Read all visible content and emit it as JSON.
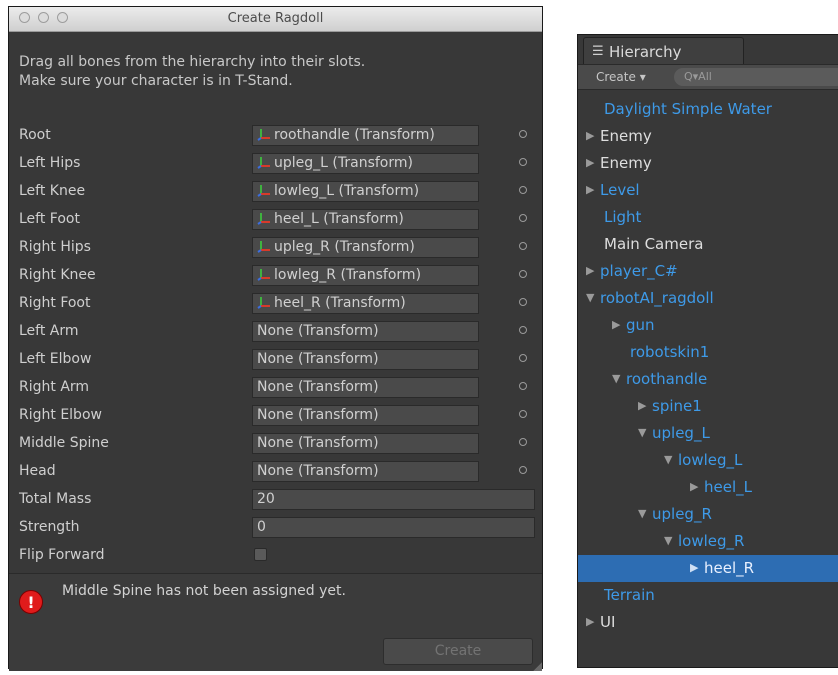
{
  "ragdoll_window": {
    "title": "Create Ragdoll",
    "instructions": [
      "Drag all bones from the hierarchy into their slots.",
      "Make sure your character is in T-Stand."
    ],
    "bone_fields": [
      {
        "label": "Root",
        "value": "roothandle (Transform)",
        "assigned": true
      },
      {
        "label": "Left Hips",
        "value": "upleg_L (Transform)",
        "assigned": true
      },
      {
        "label": "Left Knee",
        "value": "lowleg_L (Transform)",
        "assigned": true
      },
      {
        "label": "Left Foot",
        "value": "heel_L (Transform)",
        "assigned": true
      },
      {
        "label": "Right Hips",
        "value": "upleg_R (Transform)",
        "assigned": true
      },
      {
        "label": "Right Knee",
        "value": "lowleg_R (Transform)",
        "assigned": true
      },
      {
        "label": "Right Foot",
        "value": "heel_R (Transform)",
        "assigned": true
      },
      {
        "label": "Left Arm",
        "value": "None (Transform)",
        "assigned": false
      },
      {
        "label": "Left Elbow",
        "value": "None (Transform)",
        "assigned": false
      },
      {
        "label": "Right Arm",
        "value": "None (Transform)",
        "assigned": false
      },
      {
        "label": "Right Elbow",
        "value": "None (Transform)",
        "assigned": false
      },
      {
        "label": "Middle Spine",
        "value": "None (Transform)",
        "assigned": false
      },
      {
        "label": "Head",
        "value": "None (Transform)",
        "assigned": false
      }
    ],
    "total_mass": {
      "label": "Total Mass",
      "value": "20"
    },
    "strength": {
      "label": "Strength",
      "value": "0"
    },
    "flip_forward": {
      "label": "Flip Forward",
      "checked": false
    },
    "warning": "Middle Spine has not been assigned yet.",
    "create_button": "Create"
  },
  "hierarchy": {
    "tab_title": "Hierarchy",
    "create_menu": "Create ▾",
    "search_placeholder": "Q▾All",
    "nodes": [
      {
        "name": "Daylight Simple Water",
        "depth": 0,
        "arrow": "",
        "color": "active"
      },
      {
        "name": "Enemy",
        "depth": 0,
        "arrow": "▶",
        "color": "normal"
      },
      {
        "name": "Enemy",
        "depth": 0,
        "arrow": "▶",
        "color": "normal"
      },
      {
        "name": "Level",
        "depth": 0,
        "arrow": "▶",
        "color": "active"
      },
      {
        "name": "Light",
        "depth": 0,
        "arrow": "",
        "color": "active"
      },
      {
        "name": "Main Camera",
        "depth": 0,
        "arrow": "",
        "color": "normal"
      },
      {
        "name": "player_C#",
        "depth": 0,
        "arrow": "▶",
        "color": "active"
      },
      {
        "name": "robotAI_ragdoll",
        "depth": 0,
        "arrow": "▼",
        "color": "active"
      },
      {
        "name": "gun",
        "depth": 1,
        "arrow": "▶",
        "color": "active"
      },
      {
        "name": "robotskin1",
        "depth": 1,
        "arrow": "",
        "color": "active"
      },
      {
        "name": "roothandle",
        "depth": 1,
        "arrow": "▼",
        "color": "active"
      },
      {
        "name": "spine1",
        "depth": 2,
        "arrow": "▶",
        "color": "active"
      },
      {
        "name": "upleg_L",
        "depth": 2,
        "arrow": "▼",
        "color": "active"
      },
      {
        "name": "lowleg_L",
        "depth": 3,
        "arrow": "▼",
        "color": "active"
      },
      {
        "name": "heel_L",
        "depth": 4,
        "arrow": "▶",
        "color": "active"
      },
      {
        "name": "upleg_R",
        "depth": 2,
        "arrow": "▼",
        "color": "active"
      },
      {
        "name": "lowleg_R",
        "depth": 3,
        "arrow": "▼",
        "color": "active"
      },
      {
        "name": "heel_R",
        "depth": 4,
        "arrow": "▶",
        "color": "selected"
      },
      {
        "name": "Terrain",
        "depth": 0,
        "arrow": "",
        "color": "active"
      },
      {
        "name": "UI",
        "depth": 0,
        "arrow": "▶",
        "color": "normal"
      }
    ]
  },
  "colors": {
    "panel_bg": "#383838",
    "active_text": "#3e9ae8",
    "selection": "#2d6db3",
    "error": "#e01b1b"
  }
}
